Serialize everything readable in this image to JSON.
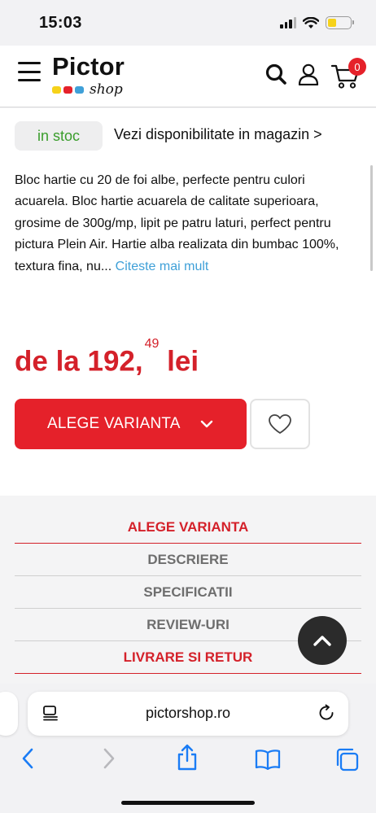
{
  "status": {
    "time": "15:03"
  },
  "header": {
    "logo_text": "Pictor",
    "logo_sub": "shop",
    "cart_count": "0",
    "logo_colors": [
      "#f6d21a",
      "#e5212a",
      "#3fa0d8"
    ]
  },
  "product": {
    "stock_label": "in stoc",
    "availability_link": "Vezi disponibilitate in magazin >",
    "description": "Bloc hartie cu 20 de foi albe, perfecte pentru culori acuarela. Bloc hartie acuarela de calitate superioara, grosime de 300g/mp, lipit pe patru laturi, perfect pentru pictura Plein Air. Hartie alba realizata din bumbac 100%, textura fina, nu...",
    "read_more": "Citeste mai mult",
    "price_prefix": "de la 192,",
    "price_cents": "49",
    "price_currency": "lei",
    "choose_variant_button": "ALEGE VARIANTA"
  },
  "tabs": [
    {
      "label": "ALEGE VARIANTA"
    },
    {
      "label": "DESCRIERE"
    },
    {
      "label": "SPECIFICATII"
    },
    {
      "label": "REVIEW-URI"
    },
    {
      "label": "LIVRARE SI RETUR"
    }
  ],
  "browser": {
    "url": "pictorshop.ro"
  },
  "colors": {
    "accent": "#e5212a",
    "link": "#3fa0d8",
    "stock": "#3a9d2c",
    "browser_blue": "#1a7cf5"
  }
}
